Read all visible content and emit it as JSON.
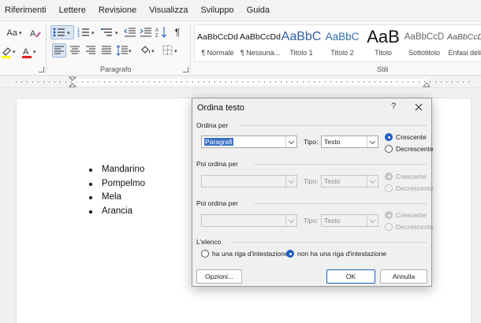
{
  "menu": {
    "tabs": [
      "Riferimenti",
      "Lettere",
      "Revisione",
      "Visualizza",
      "Sviluppo",
      "Guida"
    ]
  },
  "ribbon": {
    "font_group": {
      "font_size_label": "Aa"
    },
    "paragraph_group": {
      "label": "Paragrafo"
    },
    "styles_group": {
      "label": "Stili",
      "items": [
        {
          "preview": "AaBbCcDd",
          "name": "¶ Normale"
        },
        {
          "preview": "AaBbCcDd",
          "name": "¶ Nessuna..."
        },
        {
          "preview": "AaBbC",
          "name": "Titolo 1"
        },
        {
          "preview": "AaBbC",
          "name": "Titolo 2"
        },
        {
          "preview": "AaB",
          "name": "Titolo"
        },
        {
          "preview": "AaBbCcD",
          "name": "Sottotitolo"
        },
        {
          "preview": "AaBbCcDd",
          "name": "Enfasi deli..."
        }
      ]
    },
    "colors": {
      "highlight": "#ffff00",
      "font": "#e02020",
      "accent": "#1f5fbf"
    }
  },
  "document": {
    "items": [
      "Mandarino",
      "Pompelmo",
      "Mela",
      "Arancia"
    ]
  },
  "dialog": {
    "title": "Ordina testo",
    "help": "?",
    "sort_by": {
      "label": "Ordina per",
      "field": "Paragrafi",
      "type_label": "Tipo:",
      "type": "Testo",
      "asc": "Crescente",
      "desc": "Decrescente"
    },
    "then_by_1": {
      "label": "Poi ordina per",
      "field": "",
      "type_label": "Tipo:",
      "type": "Testo",
      "asc": "Crescente",
      "desc": "Decrescente"
    },
    "then_by_2": {
      "label": "Poi ordina per",
      "field": "",
      "type_label": "Tipo:",
      "type": "Testo",
      "asc": "Crescente",
      "desc": "Decrescente"
    },
    "list": {
      "label": "L'elenco",
      "header_yes": "ha una riga d'intestazione",
      "header_no": "non ha una riga d'intestazione"
    },
    "buttons": {
      "options": "Opzioni...",
      "ok": "OK",
      "cancel": "Annulla"
    }
  }
}
